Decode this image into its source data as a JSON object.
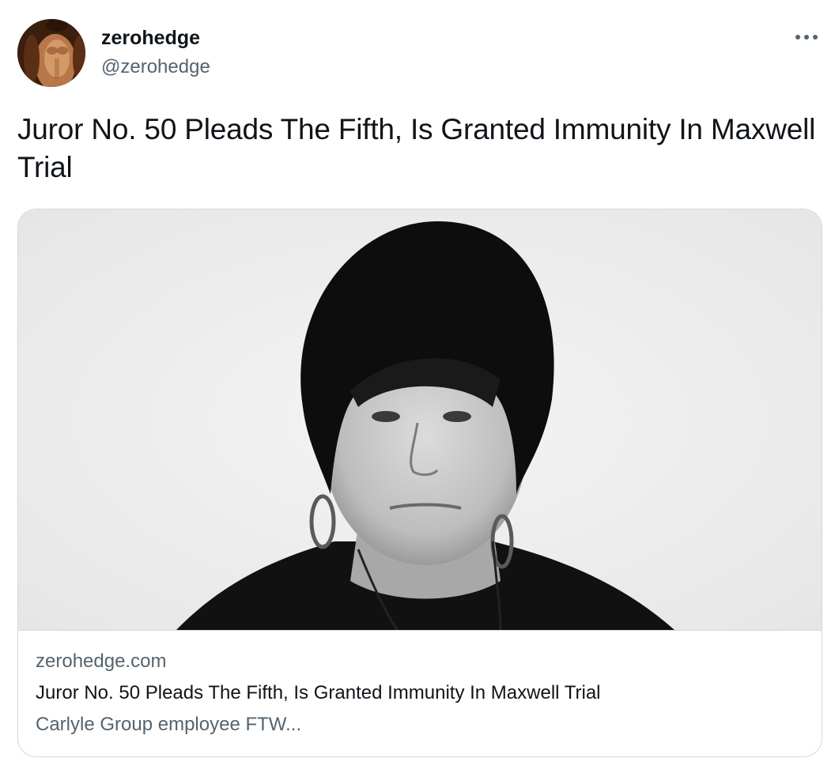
{
  "author": {
    "display_name": "zerohedge",
    "handle": "@zerohedge",
    "avatar_icon": "profile-photo"
  },
  "menu": {
    "icon": "more-horizontal-icon"
  },
  "tweet": {
    "text": "Juror No. 50 Pleads The Fifth, Is Granted Immunity In Maxwell Trial"
  },
  "link_card": {
    "domain": "zerohedge.com",
    "title": "Juror No. 50 Pleads The Fifth, Is Granted Immunity In Maxwell Trial",
    "description": "Carlyle Group employee FTW...",
    "image": "black-and-white-portrait-photo"
  },
  "colors": {
    "text_primary": "#0f1419",
    "text_secondary": "#536471",
    "border": "#cfd9de"
  }
}
